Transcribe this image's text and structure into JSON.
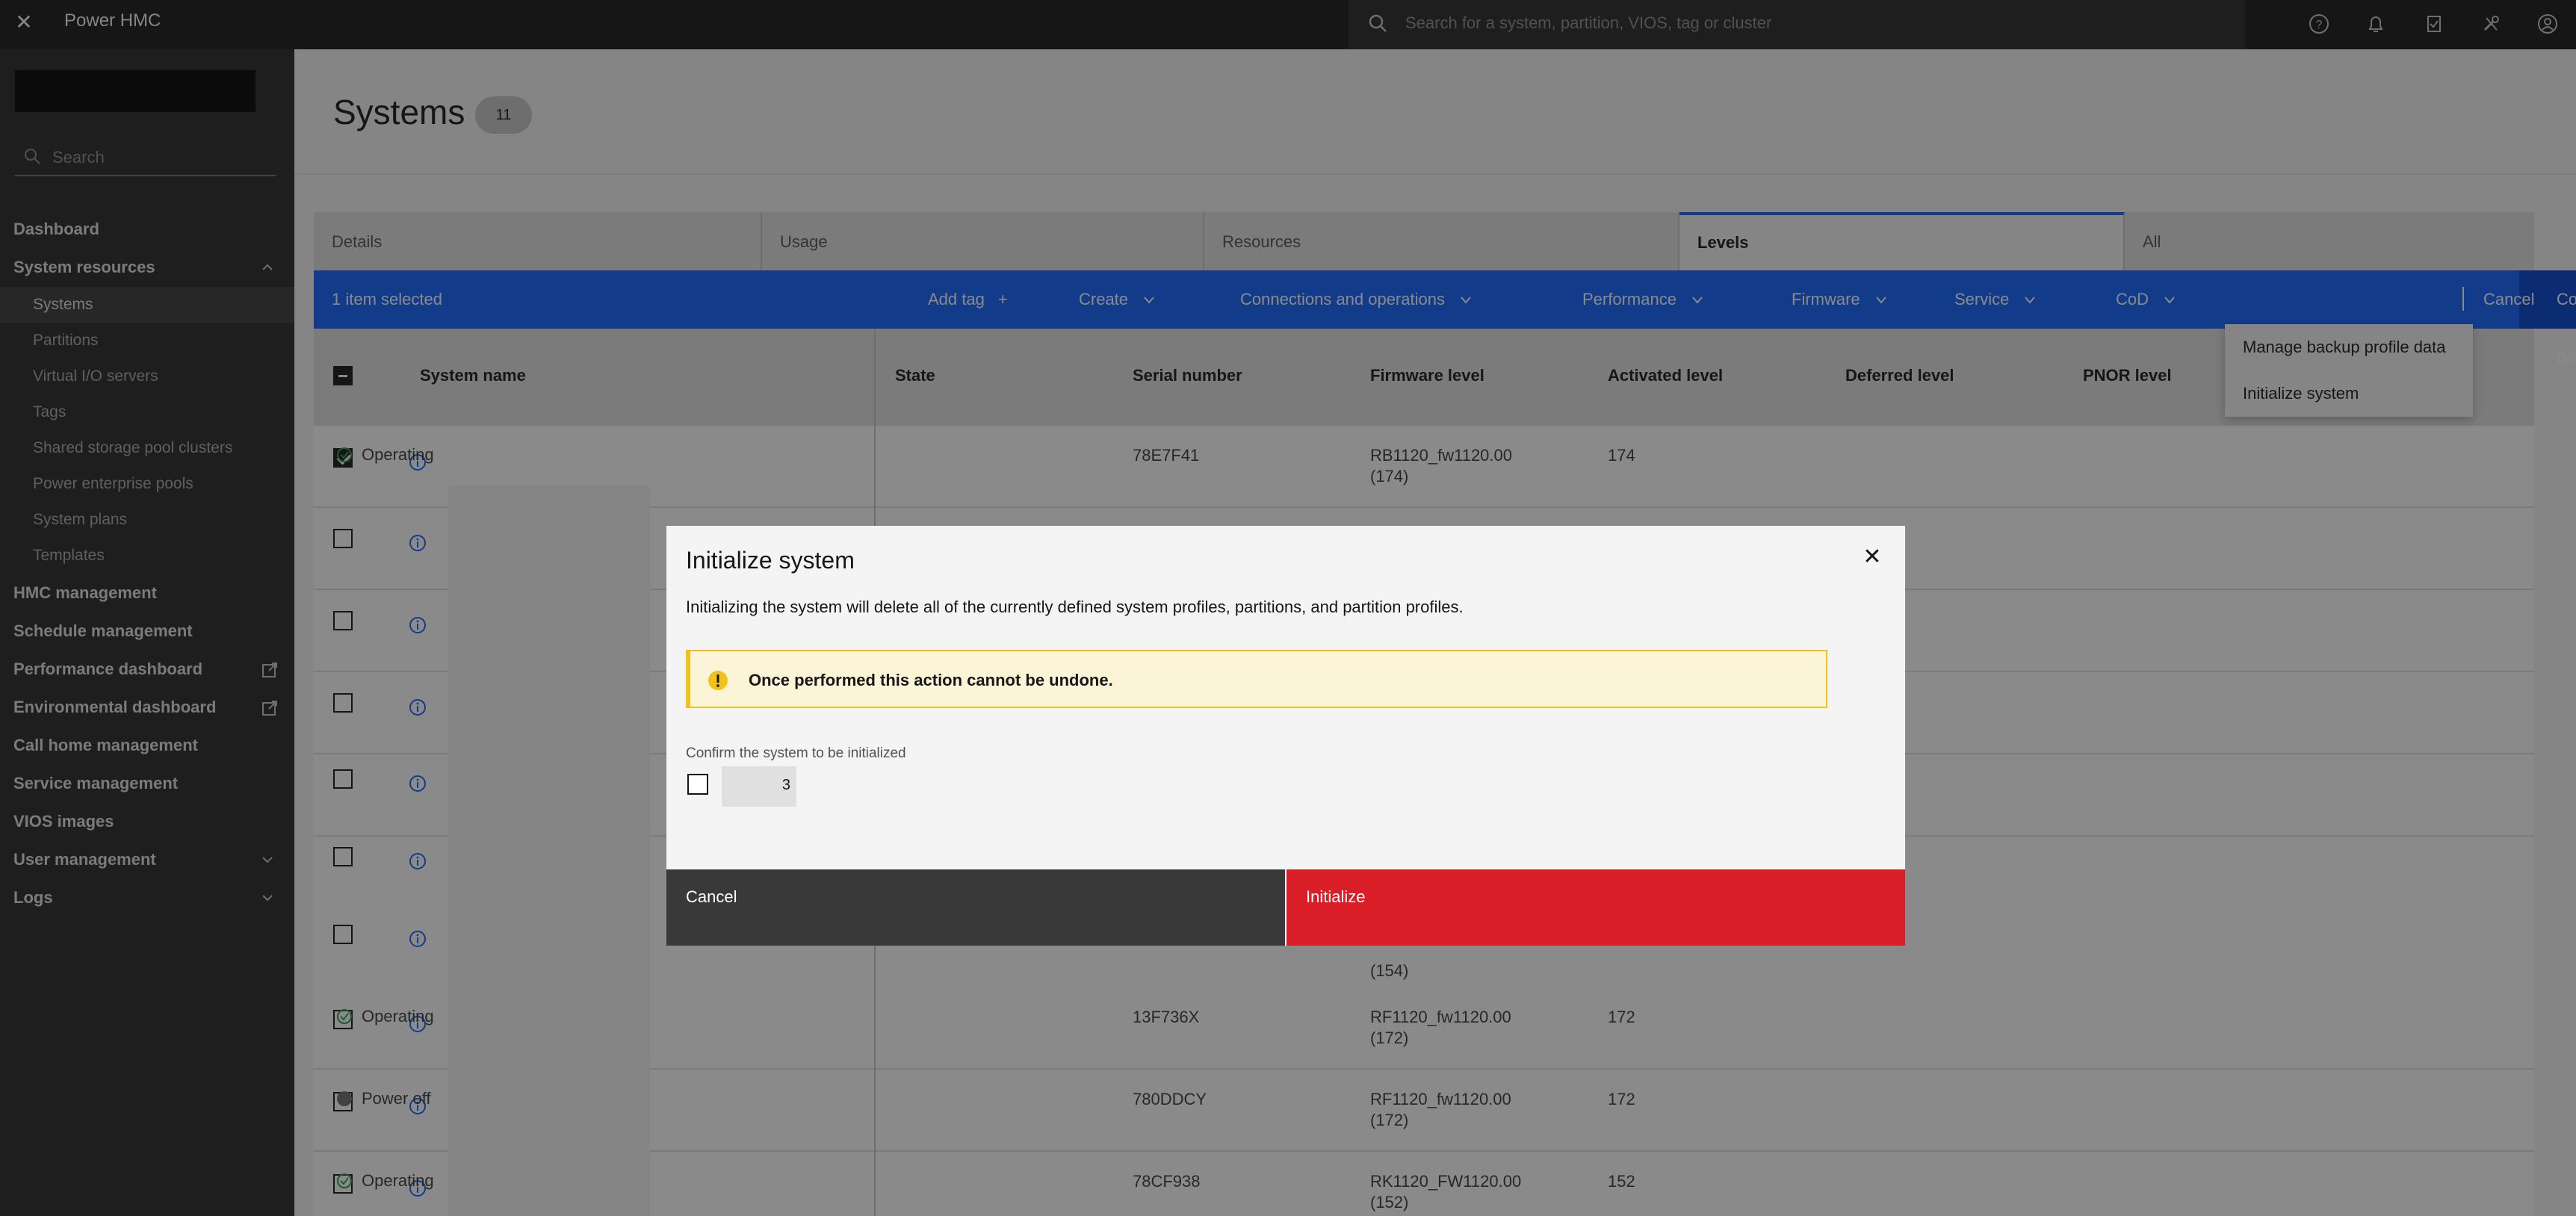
{
  "header": {
    "app_title": "Power HMC",
    "search_placeholder": "Search for a system, partition, VIOS, tag or cluster",
    "icons": [
      "close-icon",
      "help-icon",
      "notification-icon",
      "tasks-icon",
      "tools-icon",
      "user-avatar-icon"
    ]
  },
  "sidebar": {
    "search_placeholder": "Search",
    "items": [
      {
        "label": "Dashboard"
      },
      {
        "label": "System resources"
      },
      {
        "label": "Systems"
      },
      {
        "label": "Partitions"
      },
      {
        "label": "Virtual I/O servers"
      },
      {
        "label": "Tags"
      },
      {
        "label": "Shared storage pool clusters"
      },
      {
        "label": "Power enterprise pools"
      },
      {
        "label": "System plans"
      },
      {
        "label": "Templates"
      },
      {
        "label": "HMC management"
      },
      {
        "label": "Schedule management"
      },
      {
        "label": "Performance dashboard"
      },
      {
        "label": "Environmental dashboard"
      },
      {
        "label": "Call home management"
      },
      {
        "label": "Service management"
      },
      {
        "label": "VIOS images"
      },
      {
        "label": "User management"
      },
      {
        "label": "Logs"
      }
    ]
  },
  "page": {
    "title": "Systems",
    "count": "11"
  },
  "tabs": [
    {
      "label": "Details"
    },
    {
      "label": "Usage"
    },
    {
      "label": "Resources"
    },
    {
      "label": "Levels"
    },
    {
      "label": "All"
    }
  ],
  "actionbar": {
    "selection": "1 item selected",
    "add_tag": "Add tag",
    "add_tag_icon": "+",
    "create": "Create",
    "connections": "Connections and operations",
    "performance": "Performance",
    "firmware": "Firmware",
    "service": "Service",
    "cod": "CoD",
    "config_backup": "Config backup",
    "cancel": "Cancel"
  },
  "config_backup_menu": [
    {
      "label": "Manage backup profile data"
    },
    {
      "label": "Initialize system"
    }
  ],
  "table": {
    "headers": [
      "System name",
      "State",
      "Serial number",
      "Firmware level",
      "Activated level",
      "Deferred level",
      "PNOR level"
    ],
    "rows": [
      {
        "state": "Operating",
        "serial": "78E7F41",
        "firmware_1": "RB1120_fw1120.00",
        "firmware_2": "(174)",
        "activated": "174"
      },
      {
        "state": "",
        "serial": "",
        "firmware_1": "",
        "firmware_2": "",
        "activated": ""
      },
      {
        "state": "",
        "serial": "",
        "firmware_1": "",
        "firmware_2": "",
        "activated": ""
      },
      {
        "state": "",
        "serial": "",
        "firmware_1": "",
        "firmware_2": "",
        "activated": ""
      },
      {
        "state": "",
        "serial": "",
        "firmware_1": "",
        "firmware_2": "",
        "activated": ""
      },
      {
        "state": "",
        "serial": "",
        "firmware_1": "",
        "firmware_2": "",
        "activated": ""
      },
      {
        "state": "",
        "serial": "",
        "firmware_1": "",
        "firmware_2": "(154)",
        "activated": ""
      },
      {
        "state": "Operating",
        "serial": "13F736X",
        "firmware_1": "RF1120_fw1120.00",
        "firmware_2": "(172)",
        "activated": "172"
      },
      {
        "state": "Power off",
        "serial": "780DDCY",
        "firmware_1": "RF1120_fw1120.00",
        "firmware_2": "(172)",
        "activated": "172"
      },
      {
        "state": "Operating",
        "serial": "78CF938",
        "firmware_1": "RK1120_FW1120.00",
        "firmware_2": "(152)",
        "activated": "152"
      }
    ]
  },
  "modal": {
    "title": "Initialize system",
    "description": "Initializing the system will delete all of the currently defined system profiles, partitions, and partition profiles.",
    "warning": "Once performed this action cannot be undone.",
    "confirm_label": "Confirm the system to be initialized",
    "confirm_value_fragment": "3",
    "cancel_label": "Cancel",
    "initialize_label": "Initialize"
  },
  "colors": {
    "action_bar": "#0f62fe",
    "danger": "#da1e28",
    "warning_bg": "#fcf4d6",
    "warning_border": "#f1c21b",
    "operating": "#24a148",
    "power_off": "#6f6f6f"
  }
}
